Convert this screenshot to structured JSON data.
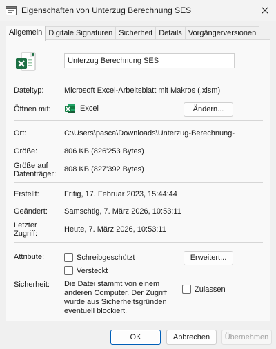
{
  "window": {
    "title": "Eigenschaften von Unterzug Berechnung SES",
    "close_icon": "close-icon"
  },
  "tabs": [
    {
      "label": "Allgemein",
      "active": true
    },
    {
      "label": "Digitale Signaturen",
      "active": false
    },
    {
      "label": "Sicherheit",
      "active": false
    },
    {
      "label": "Details",
      "active": false
    },
    {
      "label": "Vorgängerversionen",
      "active": false
    }
  ],
  "general": {
    "file_icon": "excel-file-icon",
    "file_name": "Unterzug Berechnung SES",
    "type_label": "Dateityp:",
    "type_value": "Microsoft Excel-Arbeitsblatt mit Makros (.xlsm)",
    "opens_with_label": "Öffnen mit:",
    "opens_with_app": "Excel",
    "change_button": "Ändern...",
    "location_label": "Ort:",
    "location_value": "C:\\Users\\pasca\\Downloads\\Unterzug-Berechnung-",
    "size_label": "Größe:",
    "size_value": "806 KB (826'253 Bytes)",
    "size_on_disk_label": "Größe auf Datenträger:",
    "size_on_disk_value": "808 KB (827'392 Bytes)",
    "created_label": "Erstellt:",
    "created_value": "Fritig, 17. Februar 2023, 15:44:44",
    "modified_label": "Geändert:",
    "modified_value": "Samschtig, 7. März 2026, 10:53:11",
    "accessed_label": "Letzter Zugriff:",
    "accessed_value": "Heute, 7. März 2026, 10:53:11",
    "attributes_label": "Attribute:",
    "readonly_label": "Schreibgeschützt",
    "readonly_checked": false,
    "hidden_label": "Versteckt",
    "hidden_checked": false,
    "advanced_button": "Erweitert...",
    "security_label": "Sicherheit:",
    "security_text": "Die Datei stammt von einem anderen Computer. Der Zugriff wurde aus Sicherheitsgründen eventuell blockiert.",
    "unblock_label": "Zulassen",
    "unblock_checked": false
  },
  "footer": {
    "ok": "OK",
    "cancel": "Abbrechen",
    "apply": "Übernehmen"
  },
  "colors": {
    "excel_green": "#1d7044",
    "primary_border": "#005fb8"
  }
}
